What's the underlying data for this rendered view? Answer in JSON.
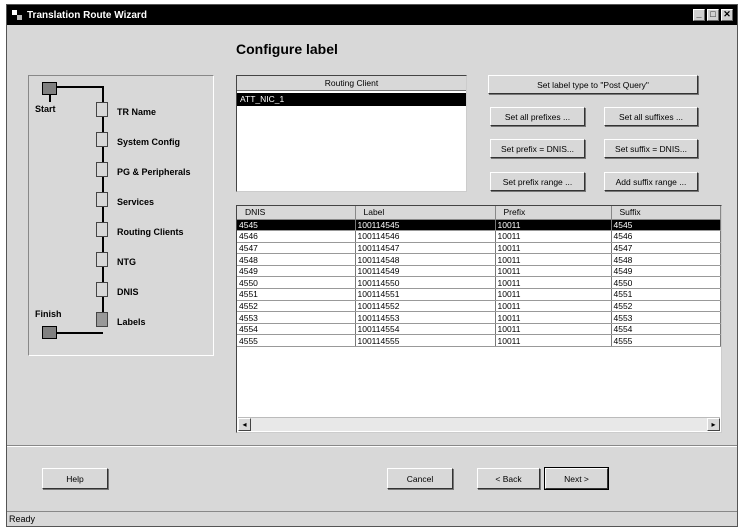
{
  "window": {
    "title": "Translation Route Wizard",
    "minimize": "_",
    "maximize": "□",
    "close": "✕"
  },
  "heading": "Configure label",
  "steps": {
    "start": "Start",
    "finish": "Finish",
    "items": [
      "TR Name",
      "System Config",
      "PG & Peripherals",
      "Services",
      "Routing Clients",
      "NTG",
      "DNIS",
      "Labels"
    ]
  },
  "routing_client": {
    "header": "Routing Client",
    "items": [
      "ATT_NIC_1"
    ]
  },
  "buttons": {
    "post_query": "Set label type to \"Post Query\"",
    "all_prefixes": "Set all prefixes ...",
    "all_suffixes": "Set all suffixes ...",
    "prefix_dnis": "Set prefix = DNIS...",
    "suffix_dnis": "Set suffix = DNIS...",
    "prefix_range": "Set prefix range ...",
    "suffix_range": "Add suffix range ...",
    "help": "Help",
    "cancel": "Cancel",
    "back": "< Back",
    "next": "Next >"
  },
  "label_table": {
    "columns": [
      "DNIS",
      "Label",
      "Prefix",
      "Suffix"
    ],
    "rows": [
      [
        "4545",
        "100114545",
        "10011",
        "4545"
      ],
      [
        "4546",
        "100114546",
        "10011",
        "4546"
      ],
      [
        "4547",
        "100114547",
        "10011",
        "4547"
      ],
      [
        "4548",
        "100114548",
        "10011",
        "4548"
      ],
      [
        "4549",
        "100114549",
        "10011",
        "4549"
      ],
      [
        "4550",
        "100114550",
        "10011",
        "4550"
      ],
      [
        "4551",
        "100114551",
        "10011",
        "4551"
      ],
      [
        "4552",
        "100114552",
        "10011",
        "4552"
      ],
      [
        "4553",
        "100114553",
        "10011",
        "4553"
      ],
      [
        "4554",
        "100114554",
        "10011",
        "4554"
      ],
      [
        "4555",
        "100114555",
        "10011",
        "4555"
      ]
    ],
    "scroll_left": "◂",
    "scroll_right": "▸"
  },
  "status": "Ready"
}
